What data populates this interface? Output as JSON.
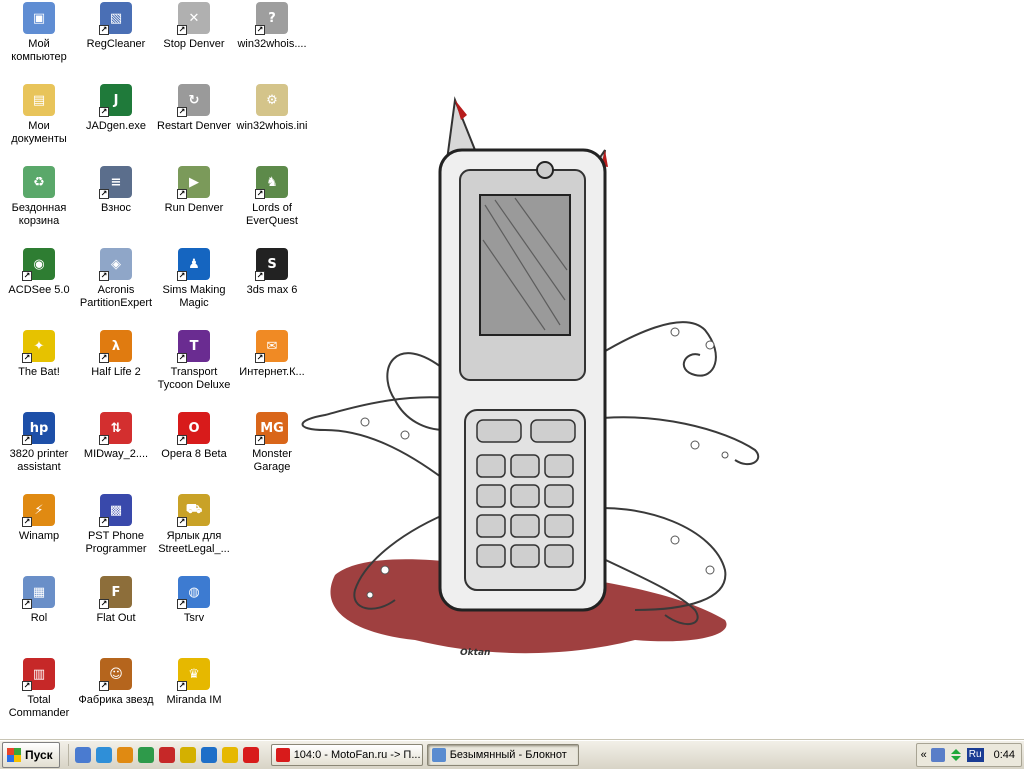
{
  "desktop": {
    "icons": [
      {
        "label": "Мой компьютер",
        "icon": "my-computer-icon",
        "color": "#5f8dd3",
        "glyph": "▣",
        "shortcut": false
      },
      {
        "label": "Мои документы",
        "icon": "my-documents-icon",
        "color": "#e8c45a",
        "glyph": "▤",
        "shortcut": false
      },
      {
        "label": "Бездонная корзина",
        "icon": "recycle-bin-icon",
        "color": "#5aa86a",
        "glyph": "♻",
        "shortcut": false
      },
      {
        "label": "ACDSee 5.0",
        "icon": "acdsee-icon",
        "color": "#2e7d32",
        "glyph": "◉",
        "shortcut": true
      },
      {
        "label": "The Bat!",
        "icon": "the-bat-icon",
        "color": "#e6c200",
        "glyph": "✦",
        "shortcut": true
      },
      {
        "label": "3820 printer assistant",
        "icon": "hp-printer-icon",
        "color": "#1d4fa8",
        "glyph": "hp",
        "shortcut": true
      },
      {
        "label": "Winamp",
        "icon": "winamp-icon",
        "color": "#e08a12",
        "glyph": "⚡",
        "shortcut": true
      },
      {
        "label": "Rol",
        "icon": "network-icon",
        "color": "#6a8fc8",
        "glyph": "▦",
        "shortcut": true
      },
      {
        "label": "Total Commander",
        "icon": "total-commander-icon",
        "color": "#c62828",
        "glyph": "▥",
        "shortcut": true
      },
      {
        "label": "RegCleaner",
        "icon": "regcleaner-icon",
        "color": "#4a6fb5",
        "glyph": "▧",
        "shortcut": true
      },
      {
        "label": "JADgen.exe",
        "icon": "jadgen-icon",
        "color": "#1f7a3a",
        "glyph": "J",
        "shortcut": true
      },
      {
        "label": "Взнос",
        "icon": "document-icon",
        "color": "#5b6e8c",
        "glyph": "≡",
        "shortcut": true
      },
      {
        "label": "Acronis PartitionExpert",
        "icon": "acronis-icon",
        "color": "#8fa6c8",
        "glyph": "◈",
        "shortcut": true
      },
      {
        "label": "Half Life 2",
        "icon": "half-life-icon",
        "color": "#e07b10",
        "glyph": "λ",
        "shortcut": true
      },
      {
        "label": "MIDway_2....",
        "icon": "midway-icon",
        "color": "#d32f2f",
        "glyph": "⇅",
        "shortcut": true
      },
      {
        "label": "PST Phone Programmer",
        "icon": "phone-programmer-icon",
        "color": "#3949ab",
        "glyph": "▩",
        "shortcut": true
      },
      {
        "label": "Flat Out",
        "icon": "flat-out-icon",
        "color": "#8d6e3a",
        "glyph": "F",
        "shortcut": true
      },
      {
        "label": "Фабрика звезд",
        "icon": "star-factory-icon",
        "color": "#b5651d",
        "glyph": "☺",
        "shortcut": true
      },
      {
        "label": "Stop Denver",
        "icon": "stop-denver-icon",
        "color": "#b0b0b0",
        "glyph": "✕",
        "shortcut": true
      },
      {
        "label": "Restart Denver",
        "icon": "restart-denver-icon",
        "color": "#9a9a9a",
        "glyph": "↻",
        "shortcut": true
      },
      {
        "label": "Run Denver",
        "icon": "run-denver-icon",
        "color": "#7b9a5a",
        "glyph": "▶",
        "shortcut": true
      },
      {
        "label": "Sims Making Magic",
        "icon": "sims-icon",
        "color": "#1565c0",
        "glyph": "♟",
        "shortcut": true
      },
      {
        "label": "Transport Tycoon Deluxe",
        "icon": "transport-tycoon-icon",
        "color": "#6a2c91",
        "glyph": "T",
        "shortcut": true
      },
      {
        "label": "Opera 8 Beta",
        "icon": "opera-icon",
        "color": "#d81b1b",
        "glyph": "O",
        "shortcut": true
      },
      {
        "label": "Ярлык для StreetLegal_...",
        "icon": "street-legal-icon",
        "color": "#c9a227",
        "glyph": "⛟",
        "shortcut": true
      },
      {
        "label": "Tsrv",
        "icon": "tsrv-icon",
        "color": "#3d7bd1",
        "glyph": "◍",
        "shortcut": true
      },
      {
        "label": "Miranda IM",
        "icon": "miranda-icon",
        "color": "#e6b800",
        "glyph": "♛",
        "shortcut": true
      },
      {
        "label": "win32whois....",
        "icon": "win32whois-exe-icon",
        "color": "#9e9e9e",
        "glyph": "?",
        "shortcut": true
      },
      {
        "label": "win32whois.ini",
        "icon": "ini-file-icon",
        "color": "#d4c48a",
        "glyph": "⚙",
        "shortcut": false
      },
      {
        "label": "Lords of EverQuest",
        "icon": "lords-everquest-icon",
        "color": "#5d8a4a",
        "glyph": "♞",
        "shortcut": true
      },
      {
        "label": "3ds max 6",
        "icon": "3ds-max-icon",
        "color": "#222222",
        "glyph": "S",
        "shortcut": true
      },
      {
        "label": "Интернет.К...",
        "icon": "internet-icon",
        "color": "#f08a24",
        "glyph": "✉",
        "shortcut": true
      },
      {
        "label": "Monster Garage",
        "icon": "monster-garage-icon",
        "color": "#d9661a",
        "glyph": "MG",
        "shortcut": true
      }
    ]
  },
  "wallpaper": {
    "signature": "Oktan"
  },
  "taskbar": {
    "start_label": "Пуск",
    "quick_launch": [
      {
        "icon": "show-desktop-icon",
        "color": "#4a7bd0"
      },
      {
        "icon": "internet-explorer-icon",
        "color": "#2f8fd8"
      },
      {
        "icon": "winamp-quick-icon",
        "color": "#e08a12"
      },
      {
        "icon": "media-player-icon",
        "color": "#2e9a4a"
      },
      {
        "icon": "total-commander-quick-icon",
        "color": "#c62828"
      },
      {
        "icon": "the-bat-quick-icon",
        "color": "#d4b000"
      },
      {
        "icon": "ie-quick-icon",
        "color": "#1e6fc8"
      },
      {
        "icon": "miranda-quick-icon",
        "color": "#e6b800"
      },
      {
        "icon": "opera-quick-icon",
        "color": "#d81b1b"
      }
    ],
    "tasks": [
      {
        "label": "104:0 - MotoFan.ru -> П...",
        "icon": "opera-task-icon",
        "color": "#d81b1b",
        "active": false
      },
      {
        "label": "Безымянный - Блокнот",
        "icon": "notepad-task-icon",
        "color": "#5a8cd0",
        "active": true
      }
    ],
    "tray": {
      "expand_label": "«",
      "language": "Ru",
      "clock": "0:44"
    }
  }
}
